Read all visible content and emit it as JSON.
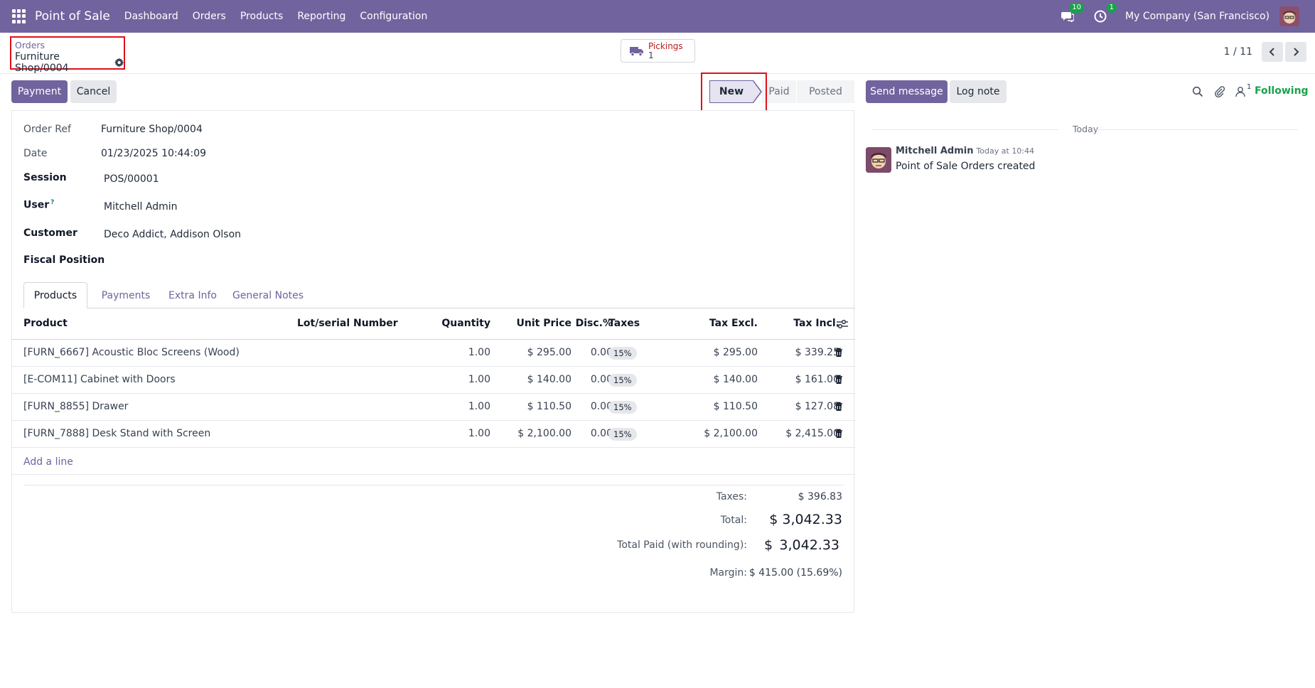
{
  "navbar": {
    "app_name": "Point of Sale",
    "menu": [
      "Dashboard",
      "Orders",
      "Products",
      "Reporting",
      "Configuration"
    ],
    "messages_badge": "10",
    "activities_badge": "1",
    "company": "My Company (San Francisco)"
  },
  "control_panel": {
    "breadcrumb_parent": "Orders",
    "breadcrumb_current": "Furniture Shop/0004",
    "pickings_label": "Pickings",
    "pickings_count": "1",
    "pager": "1 / 11"
  },
  "actions": {
    "payment": "Payment",
    "cancel": "Cancel"
  },
  "statusbar": {
    "stages": [
      "New",
      "Paid",
      "Posted"
    ],
    "current": "New"
  },
  "form": {
    "order_ref_label": "Order Ref",
    "order_ref": "Furniture Shop/0004",
    "date_label": "Date",
    "date": "01/23/2025 10:44:09",
    "session_label": "Session",
    "session": "POS/00001",
    "user_label": "User",
    "user_help": "?",
    "user": "Mitchell Admin",
    "customer_label": "Customer",
    "customer": "Deco Addict, Addison Olson",
    "fiscal_label": "Fiscal Position"
  },
  "tabs": [
    "Products",
    "Payments",
    "Extra Info",
    "General Notes"
  ],
  "table": {
    "headers": {
      "product": "Product",
      "lot": "Lot/serial Number",
      "qty": "Quantity",
      "unit_price": "Unit Price",
      "disc": "Disc.%",
      "taxes": "Taxes",
      "tax_excl": "Tax Excl.",
      "tax_incl": "Tax Incl."
    },
    "rows": [
      {
        "product": "[FURN_6667] Acoustic Bloc Screens (Wood)",
        "qty": "1.00",
        "unit_price": "$ 295.00",
        "disc": "0.00",
        "tax": "15%",
        "excl": "$ 295.00",
        "incl": "$ 339.25"
      },
      {
        "product": "[E-COM11] Cabinet with Doors",
        "qty": "1.00",
        "unit_price": "$ 140.00",
        "disc": "0.00",
        "tax": "15%",
        "excl": "$ 140.00",
        "incl": "$ 161.00"
      },
      {
        "product": "[FURN_8855] Drawer",
        "qty": "1.00",
        "unit_price": "$ 110.50",
        "disc": "0.00",
        "tax": "15%",
        "excl": "$ 110.50",
        "incl": "$ 127.08"
      },
      {
        "product": "[FURN_7888] Desk Stand with Screen",
        "qty": "1.00",
        "unit_price": "$ 2,100.00",
        "disc": "0.00",
        "tax": "15%",
        "excl": "$ 2,100.00",
        "incl": "$ 2,415.00"
      }
    ],
    "add_line": "Add a line"
  },
  "totals": {
    "taxes_label": "Taxes:",
    "taxes": "$ 396.83",
    "total_label": "Total:",
    "total": "$ 3,042.33",
    "paid_label": "Total Paid (with rounding):",
    "paid_currency": "$",
    "paid": "3,042.33",
    "margin_label": "Margin:",
    "margin": "$ 415.00 (15.69%)"
  },
  "chatter": {
    "send_message": "Send message",
    "log_note": "Log note",
    "followers_count": "1",
    "following": "Following",
    "date_separator": "Today",
    "author": "Mitchell Admin",
    "time": "Today at 10:44",
    "body": "Point of Sale Orders created"
  },
  "colors": {
    "brand": "#71639e",
    "highlight": "#e0101a",
    "following": "#17a34a"
  }
}
